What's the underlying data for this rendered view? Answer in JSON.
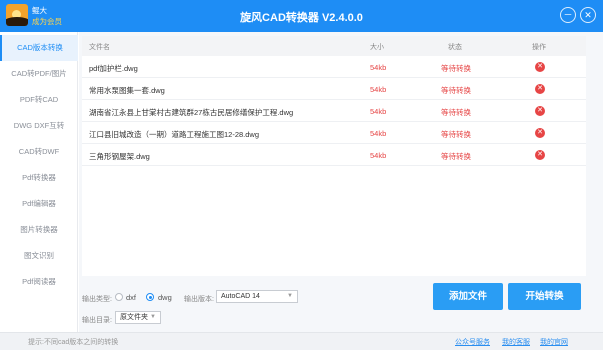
{
  "app": {
    "title": "旋风CAD转换器 V2.4.0.0",
    "user_name": "鲲大",
    "member_label": "成为会员",
    "minimize_glyph": "－",
    "close_glyph": "✕"
  },
  "sidebar": {
    "items": [
      {
        "label": "CAD版本转换",
        "active": true
      },
      {
        "label": "CAD转PDF/图片",
        "active": false
      },
      {
        "label": "PDF转CAD",
        "active": false
      },
      {
        "label": "DWG DXF互转",
        "active": false
      },
      {
        "label": "CAD转DWF",
        "active": false
      },
      {
        "label": "Pdf转换器",
        "active": false
      },
      {
        "label": "Pdf编辑器",
        "active": false
      },
      {
        "label": "图片转换器",
        "active": false
      },
      {
        "label": "图文识别",
        "active": false
      },
      {
        "label": "Pdf阅读器",
        "active": false
      }
    ]
  },
  "table": {
    "headers": {
      "name": "文件名",
      "size": "大小",
      "status": "状态",
      "action": "操作"
    },
    "rows": [
      {
        "name": "pdf加护栏.dwg",
        "size": "54kb",
        "status": "等待转换"
      },
      {
        "name": "常用水泵图集一套.dwg",
        "size": "54kb",
        "status": "等待转换"
      },
      {
        "name": "湖南省江永县上甘棠村古建筑群27栋古民居修缮保护工程.dwg",
        "size": "54kb",
        "status": "等待转换"
      },
      {
        "name": "江口县旧城改造（一期）道路工程施工图12-28.dwg",
        "size": "54kb",
        "status": "等待转换"
      },
      {
        "name": "三角形钢屋架.dwg",
        "size": "54kb",
        "status": "等待转换"
      }
    ],
    "delete_glyph": "✕"
  },
  "actions": {
    "add_file": "添加文件",
    "start_convert": "开始转换"
  },
  "options": {
    "output_type_label": "输出类型:",
    "type_dxf": "dxf",
    "type_dwg": "dwg",
    "selected_type": "dwg",
    "output_version_label": "输出版本:",
    "version_value": "AutoCAD 14",
    "output_dir_label": "输出目录:",
    "dir_value": "原文件夹",
    "chevron_glyph": "▼"
  },
  "statusbar": {
    "tip": "提示:不同cad版本之间的转换",
    "link_wechat": "公众号服务",
    "link_service": "我的客服",
    "link_site": "我的官网"
  },
  "colors": {
    "accent": "#1e8df5",
    "button": "#2a9df4",
    "warning": "#e64545"
  }
}
